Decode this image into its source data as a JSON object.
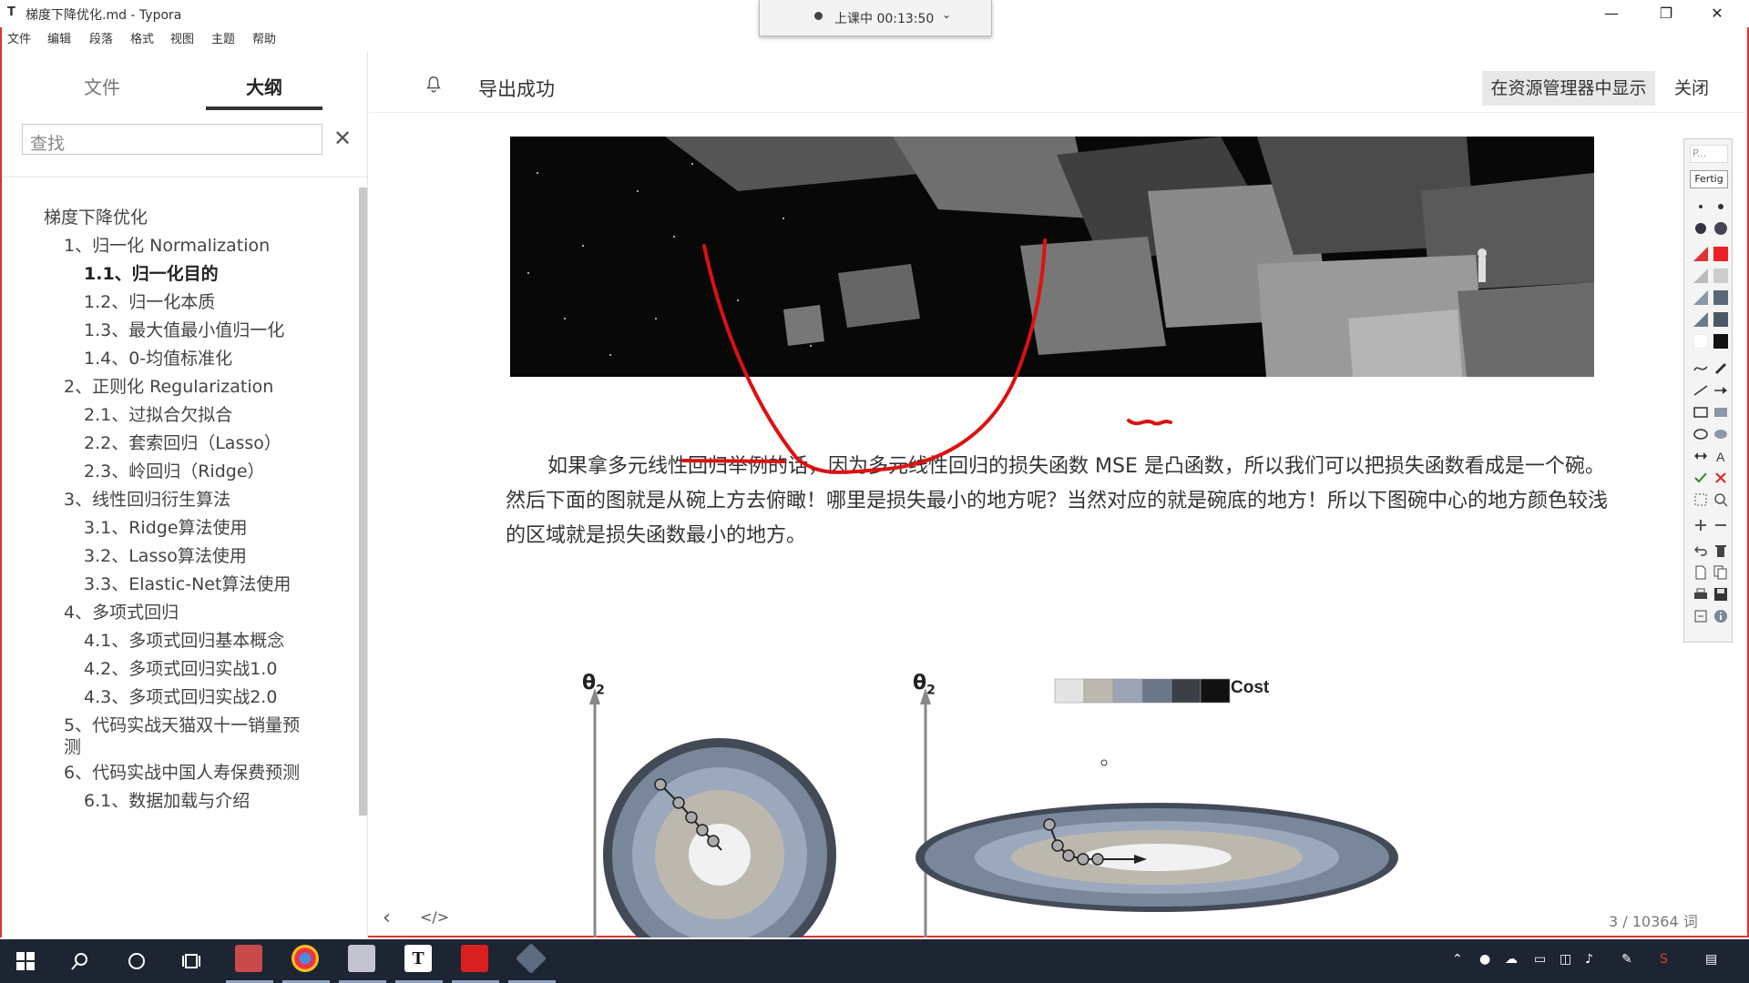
{
  "window": {
    "title": "梯度下降优化.md - Typora",
    "app_icon": "T",
    "menu": [
      "文件",
      "编辑",
      "段落",
      "格式",
      "视图",
      "主题",
      "帮助"
    ],
    "minimize": "—",
    "restore": "❐",
    "close": "✕"
  },
  "timer": {
    "label": "上课中 00:13:50",
    "chevron": "⌄"
  },
  "sidebar": {
    "tab_files": "文件",
    "tab_outline": "大纲",
    "search_placeholder": "查找",
    "search_close": "✕",
    "outline": [
      {
        "label": "梯度下降优化",
        "level": 0
      },
      {
        "label": "1、归一化 Normalization",
        "level": 1
      },
      {
        "label": "1.1、归一化目的",
        "level": 2,
        "active": true
      },
      {
        "label": "1.2、归一化本质",
        "level": 2
      },
      {
        "label": "1.3、最大值最小值归一化",
        "level": 2
      },
      {
        "label": "1.4、0-均值标准化",
        "level": 2
      },
      {
        "label": "2、正则化 Regularization",
        "level": 1
      },
      {
        "label": "2.1、过拟合欠拟合",
        "level": 2
      },
      {
        "label": "2.2、套索回归（Lasso）",
        "level": 2
      },
      {
        "label": "2.3、岭回归（Ridge）",
        "level": 2
      },
      {
        "label": "3、线性回归衍生算法",
        "level": 1
      },
      {
        "label": "3.1、Ridge算法使用",
        "level": 2
      },
      {
        "label": "3.2、Lasso算法使用",
        "level": 2
      },
      {
        "label": "3.3、Elastic-Net算法使用",
        "level": 2
      },
      {
        "label": "4、多项式回归",
        "level": 1
      },
      {
        "label": "4.1、多项式回归基本概念",
        "level": 2
      },
      {
        "label": "4.2、多项式回归实战1.0",
        "level": 2
      },
      {
        "label": "4.3、多项式回归实战2.0",
        "level": 2
      },
      {
        "label": "5、代码实战天猫双十一销量预",
        "level": 1
      },
      {
        "label": "测",
        "level": 1
      },
      {
        "label": "6、代码实战中国人寿保费预测",
        "level": 1
      },
      {
        "label": "6.1、数据加载与介绍",
        "level": 2
      }
    ]
  },
  "notice": {
    "text": "导出成功",
    "reveal_button": "在资源管理器中显示",
    "close_button": "关闭"
  },
  "editor": {
    "paragraph": "如果拿多元线性回归举例的话，因为多元线性回归的损失函数 MSE 是凸函数，所以我们可以把损失函数看成是一个碗。然后下面的图就是从碗上方去俯瞰！哪里是损失最小的地方呢？当然对应的就是碗底的地方！所以下图碗中心的地方颜色较浅的区域就是损失函数最小的地方。",
    "figure": {
      "theta_left": "θ",
      "theta_right": "θ",
      "subscript": "2",
      "legend_label": "Cost",
      "legend_colors": [
        "#e4e4e4",
        "#bdb8b0",
        "#9aa4b4",
        "#6a7788",
        "#3b3f46",
        "#111111"
      ]
    },
    "word_count": "3 / 10364 词",
    "nav_prev": "‹",
    "source_toggle": "</>"
  },
  "draw_toolbar": {
    "placeholder": "P...",
    "done_button": "Fertig"
  },
  "taskbar": {
    "apps": [
      "start",
      "search",
      "cortana",
      "task-view",
      "file-manager",
      "chrome",
      "paint",
      "typora",
      "pdf",
      "media"
    ]
  }
}
